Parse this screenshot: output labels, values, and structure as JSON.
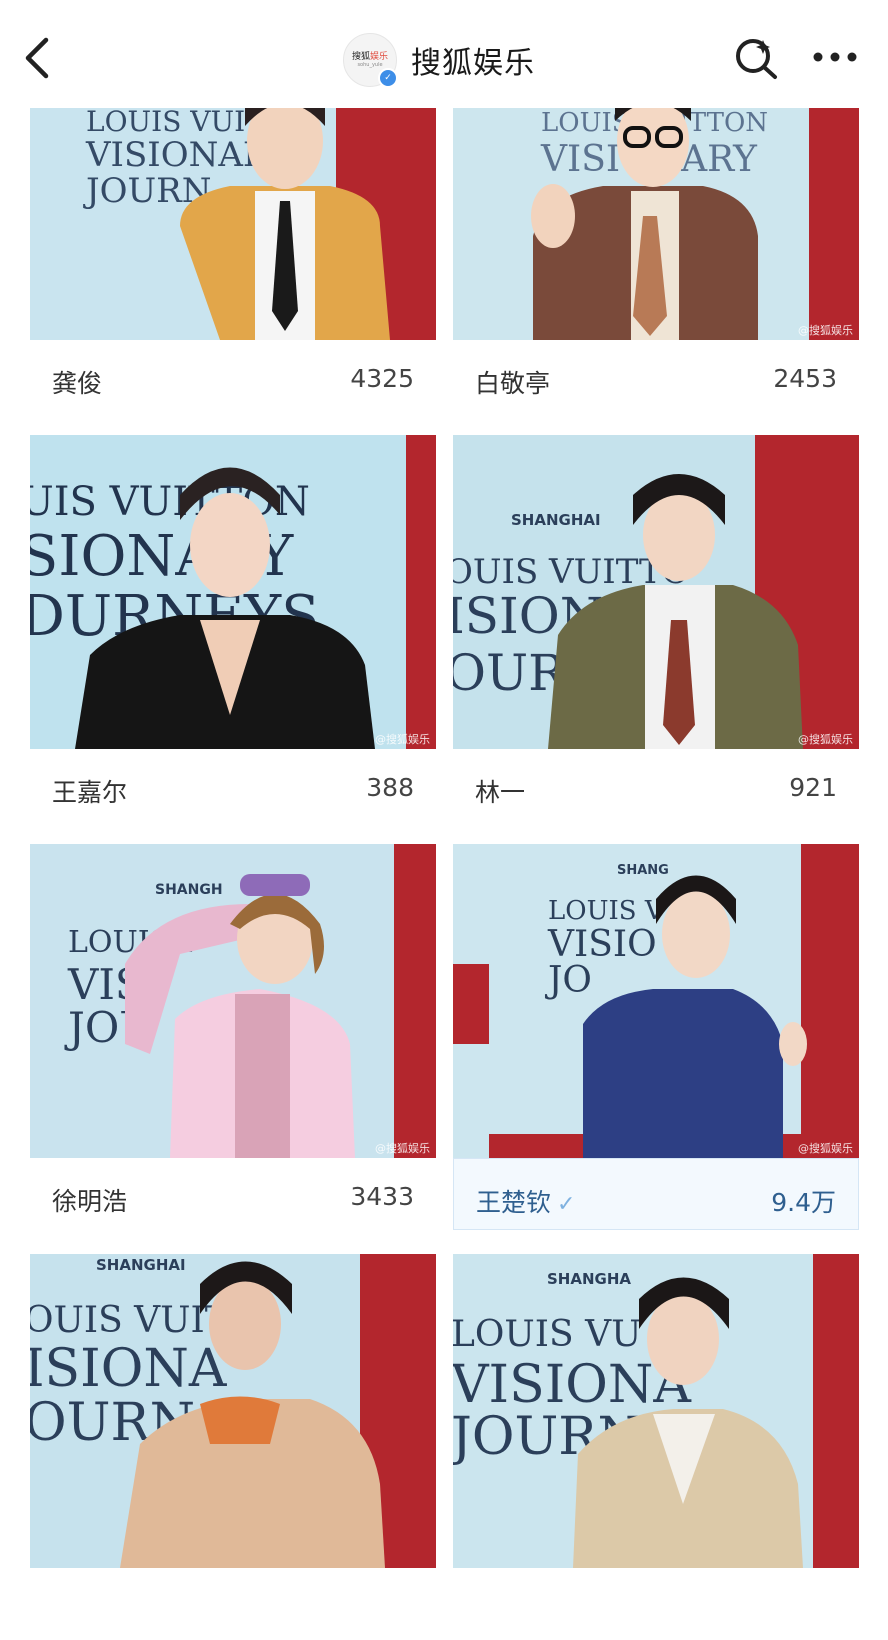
{
  "header": {
    "title": "搜狐娱乐",
    "avatar_text_main": "搜狐",
    "avatar_text_accent": "娱乐",
    "avatar_text_sub": "sohu_yule"
  },
  "colors": {
    "accent_blue": "#3d8ee8",
    "wall_blue": "#b9dbe8",
    "wall_red": "#b3262d"
  },
  "cards": [
    {
      "name": "龚俊",
      "count": "4325"
    },
    {
      "name": "白敬亭",
      "count": "2453",
      "watermark": "@搜狐娱乐"
    },
    {
      "name": "王嘉尔",
      "count": "388",
      "watermark": "@搜狐娱乐"
    },
    {
      "name": "林一",
      "count": "921",
      "watermark": "@搜狐娱乐"
    },
    {
      "name": "徐明浩",
      "count": "3433",
      "watermark": "@搜狐娱乐"
    },
    {
      "name": "王楚钦",
      "count": "9.4万",
      "watermark": "@搜狐娱乐"
    },
    {
      "name": "",
      "count": ""
    },
    {
      "name": "",
      "count": ""
    }
  ],
  "backdrop": {
    "line1": "LOUIS VUITTON",
    "line2": "VISIONARY",
    "line3": "JOURNEYS",
    "city": "SHANGHAI"
  }
}
